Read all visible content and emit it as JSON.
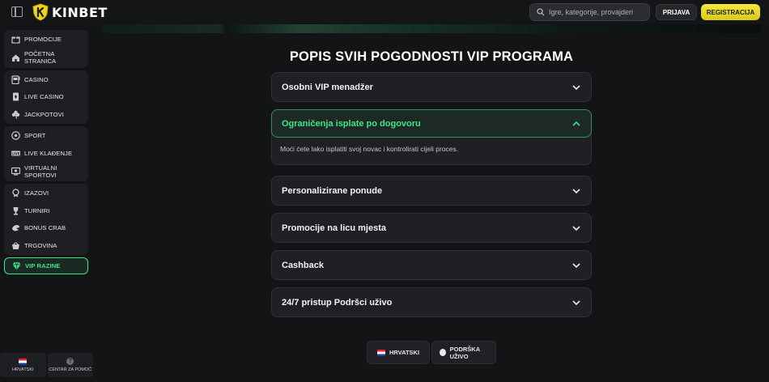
{
  "header": {
    "brand": "KINBET",
    "search_placeholder": "Igre, kategorije, provajderi",
    "login_label": "PRIJAVA",
    "register_label": "REGISTRACIJA",
    "colors": {
      "accent_green": "#3de58a",
      "register_yellow": "#e8dc2a",
      "background": "#131416"
    }
  },
  "sidebar": {
    "groups": [
      [
        {
          "label": "PROMOCIJE",
          "icon": "gift-icon"
        },
        {
          "label": "POČETNA STRANICA",
          "icon": "home-icon"
        }
      ],
      [
        {
          "label": "CASINO",
          "icon": "slot-machine-icon"
        },
        {
          "label": "LIVE CASINO",
          "icon": "playing-card-icon"
        },
        {
          "label": "JACKPOTOVI",
          "icon": "clover-icon"
        }
      ],
      [
        {
          "label": "SPORT",
          "icon": "soccer-ball-icon"
        },
        {
          "label": "LIVE KLAĐENJE",
          "icon": "live-badge-icon"
        },
        {
          "label": "VIRTUALNI SPORTOVI",
          "icon": "virtual-screen-icon"
        }
      ],
      [
        {
          "label": "IZAZOVI",
          "icon": "medal-icon"
        },
        {
          "label": "TURNIRI",
          "icon": "trophy-icon"
        },
        {
          "label": "BONUS CRAB",
          "icon": "crab-icon"
        },
        {
          "label": "TRGOVINA",
          "icon": "basket-icon"
        }
      ],
      [
        {
          "label": "VIP RAZINE",
          "icon": "diamond-icon",
          "active": true
        }
      ]
    ],
    "bottom": {
      "language": "HRVATSKI",
      "help": "CENTAR ZA POMOĆ"
    }
  },
  "main": {
    "title": "POPIS SVIH POGODNOSTI VIP PROGRAMA",
    "accordion": [
      {
        "title": "Osobni VIP menadžer",
        "open": false
      },
      {
        "title": "Ograničenja isplate po dogovoru",
        "open": true,
        "body": "Moći ćete lako isplatiti svoj novac i kontrolirati cijeli proces."
      },
      {
        "title": "Personalizirane ponude",
        "open": false
      },
      {
        "title": "Promocije na licu mjesta",
        "open": false
      },
      {
        "title": "Cashback",
        "open": false
      },
      {
        "title": "24/7 pristup Podršci uživo",
        "open": false
      }
    ],
    "footer": {
      "language": "HRVATSKI",
      "support": "PODRŠKA UŽIVO"
    }
  }
}
